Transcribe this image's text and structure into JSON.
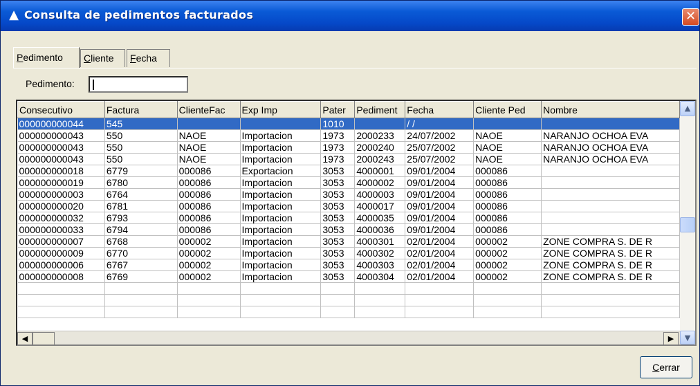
{
  "window": {
    "title": "Consulta de pedimentos facturados",
    "close_label": "✕"
  },
  "tabs": [
    {
      "label": "Pedimento",
      "accel": "P",
      "rest": "edimento"
    },
    {
      "label": "Cliente",
      "accel": "C",
      "rest": "liente"
    },
    {
      "label": "Fecha",
      "accel": "F",
      "rest": "echa"
    }
  ],
  "search": {
    "label": "Pedimento:",
    "value": ""
  },
  "grid": {
    "columns": [
      "Consecutivo",
      "Factura",
      "ClienteFac",
      "Exp Imp",
      "Pater",
      "Pediment",
      "Fecha",
      "Cliente Ped",
      "Nombre"
    ],
    "rows": [
      [
        "000000000044",
        "545",
        "",
        "",
        "1010",
        "",
        "  /  /",
        "",
        ""
      ],
      [
        "000000000043",
        "550",
        "NAOE",
        "Importacion",
        "1973",
        "2000233",
        "24/07/2002",
        "NAOE",
        "NARANJO OCHOA EVA"
      ],
      [
        "000000000043",
        "550",
        "NAOE",
        "Importacion",
        "1973",
        "2000240",
        "25/07/2002",
        "NAOE",
        "NARANJO OCHOA EVA"
      ],
      [
        "000000000043",
        "550",
        "NAOE",
        "Importacion",
        "1973",
        "2000243",
        "25/07/2002",
        "NAOE",
        "NARANJO OCHOA EVA"
      ],
      [
        "000000000018",
        "6779",
        "000086",
        "Exportacion",
        "3053",
        "4000001",
        "09/01/2004",
        "000086",
        ""
      ],
      [
        "000000000019",
        "6780",
        "000086",
        "Importacion",
        "3053",
        "4000002",
        "09/01/2004",
        "000086",
        ""
      ],
      [
        "000000000003",
        "6764",
        "000086",
        "Importacion",
        "3053",
        "4000003",
        "09/01/2004",
        "000086",
        ""
      ],
      [
        "000000000020",
        "6781",
        "000086",
        "Importacion",
        "3053",
        "4000017",
        "09/01/2004",
        "000086",
        ""
      ],
      [
        "000000000032",
        "6793",
        "000086",
        "Importacion",
        "3053",
        "4000035",
        "09/01/2004",
        "000086",
        ""
      ],
      [
        "000000000033",
        "6794",
        "000086",
        "Importacion",
        "3053",
        "4000036",
        "09/01/2004",
        "000086",
        ""
      ],
      [
        "000000000007",
        "6768",
        "000002",
        "Importacion",
        "3053",
        "4000301",
        "02/01/2004",
        "000002",
        "ZONE COMPRA S. DE R"
      ],
      [
        "000000000009",
        "6770",
        "000002",
        "Importacion",
        "3053",
        "4000302",
        "02/01/2004",
        "000002",
        "ZONE COMPRA S. DE R"
      ],
      [
        "000000000006",
        "6767",
        "000002",
        "Importacion",
        "3053",
        "4000303",
        "02/01/2004",
        "000002",
        "ZONE COMPRA S. DE R"
      ],
      [
        "000000000008",
        "6769",
        "000002",
        "Importacion",
        "3053",
        "4000304",
        "02/01/2004",
        "000002",
        "ZONE COMPRA S. DE R"
      ]
    ],
    "selected_row": 0
  },
  "buttons": {
    "close": "Cerrar",
    "close_accel": "C",
    "close_rest": "errar"
  },
  "colors": {
    "titlebar": "#0548c8",
    "selection": "#316ac5",
    "face": "#ece9d8"
  }
}
